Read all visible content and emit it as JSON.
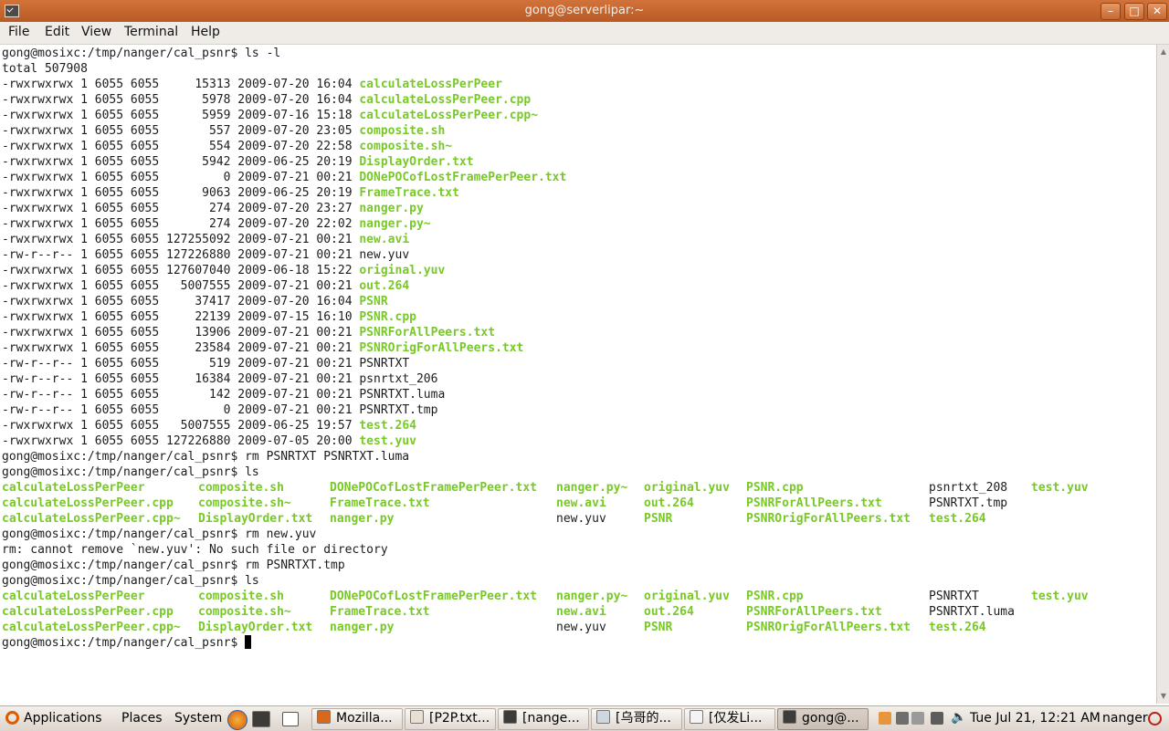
{
  "window": {
    "title": "gong@serverlipar:~",
    "controls": [
      "minimize",
      "maximize",
      "close"
    ]
  },
  "menu": [
    "File",
    "Edit",
    "View",
    "Terminal",
    "Help"
  ],
  "terminal": {
    "prompt": "gong@mosixc:/tmp/nanger/cal_psnr$ ",
    "cmd1": "ls -l",
    "total": "total 507908",
    "ls_long": [
      {
        "perm": "-rwxrwxrwx",
        "rest": " 1 6055 6055     15313 2009-07-20 16:04 ",
        "name": "calculateLossPerPeer",
        "colored": true
      },
      {
        "perm": "-rwxrwxrwx",
        "rest": " 1 6055 6055      5978 2009-07-20 16:04 ",
        "name": "calculateLossPerPeer.cpp",
        "colored": true
      },
      {
        "perm": "-rwxrwxrwx",
        "rest": " 1 6055 6055      5959 2009-07-16 15:18 ",
        "name": "calculateLossPerPeer.cpp~",
        "colored": true
      },
      {
        "perm": "-rwxrwxrwx",
        "rest": " 1 6055 6055       557 2009-07-20 23:05 ",
        "name": "composite.sh",
        "colored": true
      },
      {
        "perm": "-rwxrwxrwx",
        "rest": " 1 6055 6055       554 2009-07-20 22:58 ",
        "name": "composite.sh~",
        "colored": true
      },
      {
        "perm": "-rwxrwxrwx",
        "rest": " 1 6055 6055      5942 2009-06-25 20:19 ",
        "name": "DisplayOrder.txt",
        "colored": true
      },
      {
        "perm": "-rwxrwxrwx",
        "rest": " 1 6055 6055         0 2009-07-21 00:21 ",
        "name": "DONePOCofLostFramePerPeer.txt",
        "colored": true
      },
      {
        "perm": "-rwxrwxrwx",
        "rest": " 1 6055 6055      9063 2009-06-25 20:19 ",
        "name": "FrameTrace.txt",
        "colored": true
      },
      {
        "perm": "-rwxrwxrwx",
        "rest": " 1 6055 6055       274 2009-07-20 23:27 ",
        "name": "nanger.py",
        "colored": true
      },
      {
        "perm": "-rwxrwxrwx",
        "rest": " 1 6055 6055       274 2009-07-20 22:02 ",
        "name": "nanger.py~",
        "colored": true
      },
      {
        "perm": "-rwxrwxrwx",
        "rest": " 1 6055 6055 127255092 2009-07-21 00:21 ",
        "name": "new.avi",
        "colored": true
      },
      {
        "perm": "-rw-r--r--",
        "rest": " 1 6055 6055 127226880 2009-07-21 00:21 ",
        "name": "new.yuv",
        "colored": false
      },
      {
        "perm": "-rwxrwxrwx",
        "rest": " 1 6055 6055 127607040 2009-06-18 15:22 ",
        "name": "original.yuv",
        "colored": true
      },
      {
        "perm": "-rwxrwxrwx",
        "rest": " 1 6055 6055   5007555 2009-07-21 00:21 ",
        "name": "out.264",
        "colored": true
      },
      {
        "perm": "-rwxrwxrwx",
        "rest": " 1 6055 6055     37417 2009-07-20 16:04 ",
        "name": "PSNR",
        "colored": true
      },
      {
        "perm": "-rwxrwxrwx",
        "rest": " 1 6055 6055     22139 2009-07-15 16:10 ",
        "name": "PSNR.cpp",
        "colored": true
      },
      {
        "perm": "-rwxrwxrwx",
        "rest": " 1 6055 6055     13906 2009-07-21 00:21 ",
        "name": "PSNRForAllPeers.txt",
        "colored": true
      },
      {
        "perm": "-rwxrwxrwx",
        "rest": " 1 6055 6055     23584 2009-07-21 00:21 ",
        "name": "PSNROrigForAllPeers.txt",
        "colored": true
      },
      {
        "perm": "-rw-r--r--",
        "rest": " 1 6055 6055       519 2009-07-21 00:21 ",
        "name": "PSNRTXT",
        "colored": false
      },
      {
        "perm": "-rw-r--r--",
        "rest": " 1 6055 6055     16384 2009-07-21 00:21 ",
        "name": "psnrtxt_206",
        "colored": false
      },
      {
        "perm": "-rw-r--r--",
        "rest": " 1 6055 6055       142 2009-07-21 00:21 ",
        "name": "PSNRTXT.luma",
        "colored": false
      },
      {
        "perm": "-rw-r--r--",
        "rest": " 1 6055 6055         0 2009-07-21 00:21 ",
        "name": "PSNRTXT.tmp",
        "colored": false
      },
      {
        "perm": "-rwxrwxrwx",
        "rest": " 1 6055 6055   5007555 2009-06-25 19:57 ",
        "name": "test.264",
        "colored": true
      },
      {
        "perm": "-rwxrwxrwx",
        "rest": " 1 6055 6055 127226880 2009-07-05 20:00 ",
        "name": "test.yuv",
        "colored": true
      }
    ],
    "cmd2": "rm PSNRTXT PSNRTXT.luma",
    "cmd3": "ls",
    "ls1": [
      [
        "calculateLossPerPeer",
        "composite.sh",
        "DONePOCofLostFramePerPeer.txt",
        "nanger.py~",
        "original.yuv",
        "PSNR.cpp",
        "psnrtxt_208",
        "test.yuv"
      ],
      [
        "calculateLossPerPeer.cpp",
        "composite.sh~",
        "FrameTrace.txt",
        "new.avi",
        "out.264",
        "PSNRForAllPeers.txt",
        "PSNRTXT.tmp",
        ""
      ],
      [
        "calculateLossPerPeer.cpp~",
        "DisplayOrder.txt",
        "nanger.py",
        "new.yuv",
        "PSNR",
        "PSNROrigForAllPeers.txt",
        "test.264",
        ""
      ]
    ],
    "cmd4": "rm new.yuv",
    "error": "rm: cannot remove `new.yuv': No such file or directory",
    "cmd5": "rm PSNRTXT.tmp",
    "cmd6": "ls",
    "ls2": [
      [
        "calculateLossPerPeer",
        "composite.sh",
        "DONePOCofLostFramePerPeer.txt",
        "nanger.py~",
        "original.yuv",
        "PSNR.cpp",
        "PSNRTXT",
        "test.yuv"
      ],
      [
        "calculateLossPerPeer.cpp",
        "composite.sh~",
        "FrameTrace.txt",
        "new.avi",
        "out.264",
        "PSNRForAllPeers.txt",
        "PSNRTXT.luma",
        ""
      ],
      [
        "calculateLossPerPeer.cpp~",
        "DisplayOrder.txt",
        "nanger.py",
        "new.yuv",
        "PSNR",
        "PSNROrigForAllPeers.txt",
        "test.264",
        ""
      ]
    ],
    "plain_names": [
      "new.yuv",
      "PSNRTXT",
      "psnrtxt_208",
      "PSNRTXT.tmp",
      "PSNRTXT.luma"
    ],
    "colors": {
      "exec": "#78c928",
      "text": "#1c1c1c",
      "background": "#ffffff"
    }
  },
  "panel": {
    "menus": [
      "Applications",
      "Places",
      "System"
    ],
    "tasks": [
      {
        "label": "Mozilla...",
        "icon": "firefox-icon"
      },
      {
        "label": "[P2P.txt...",
        "icon": "text-editor-icon"
      },
      {
        "label": "[nange...",
        "icon": "terminal-icon"
      },
      {
        "label": "[乌哥的...",
        "icon": "document-icon"
      },
      {
        "label": "[仅发Li...",
        "icon": "window-icon"
      },
      {
        "label": "gong@...",
        "icon": "terminal-icon"
      }
    ],
    "clock": "Tue Jul 21, 12:21 AM",
    "user": "nanger"
  }
}
